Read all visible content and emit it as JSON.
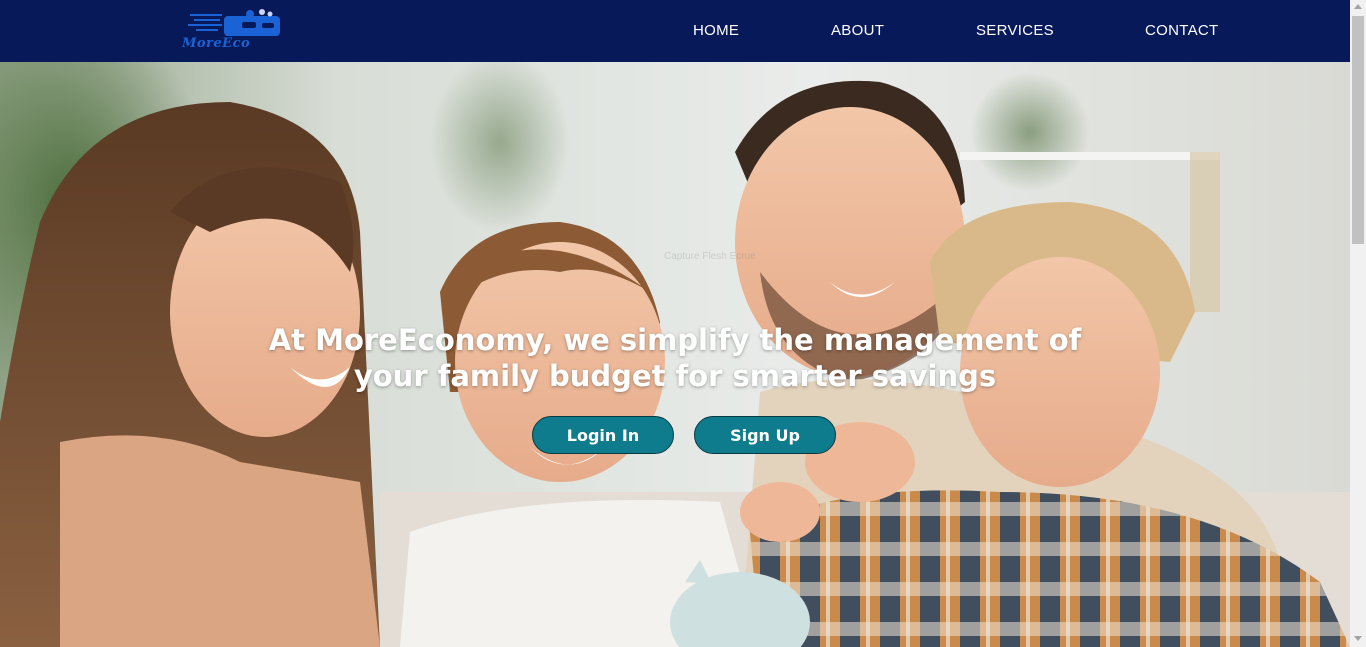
{
  "brand": {
    "logo_text": "MoreEco",
    "logo_icon": "piggy-bank-icon",
    "navbar_color": "#08195a"
  },
  "nav": {
    "items": [
      {
        "label": "HOME"
      },
      {
        "label": "ABOUT"
      },
      {
        "label": "SERVICES"
      },
      {
        "label": "CONTACT"
      }
    ]
  },
  "hero": {
    "headline": "At MoreEconomy, we simplify the management of your family budget for smarter savings",
    "image": "family-saving-photo",
    "buttons": {
      "login_label": "Login In",
      "signup_label": "Sign Up"
    },
    "button_color": "#0f7c8e"
  }
}
